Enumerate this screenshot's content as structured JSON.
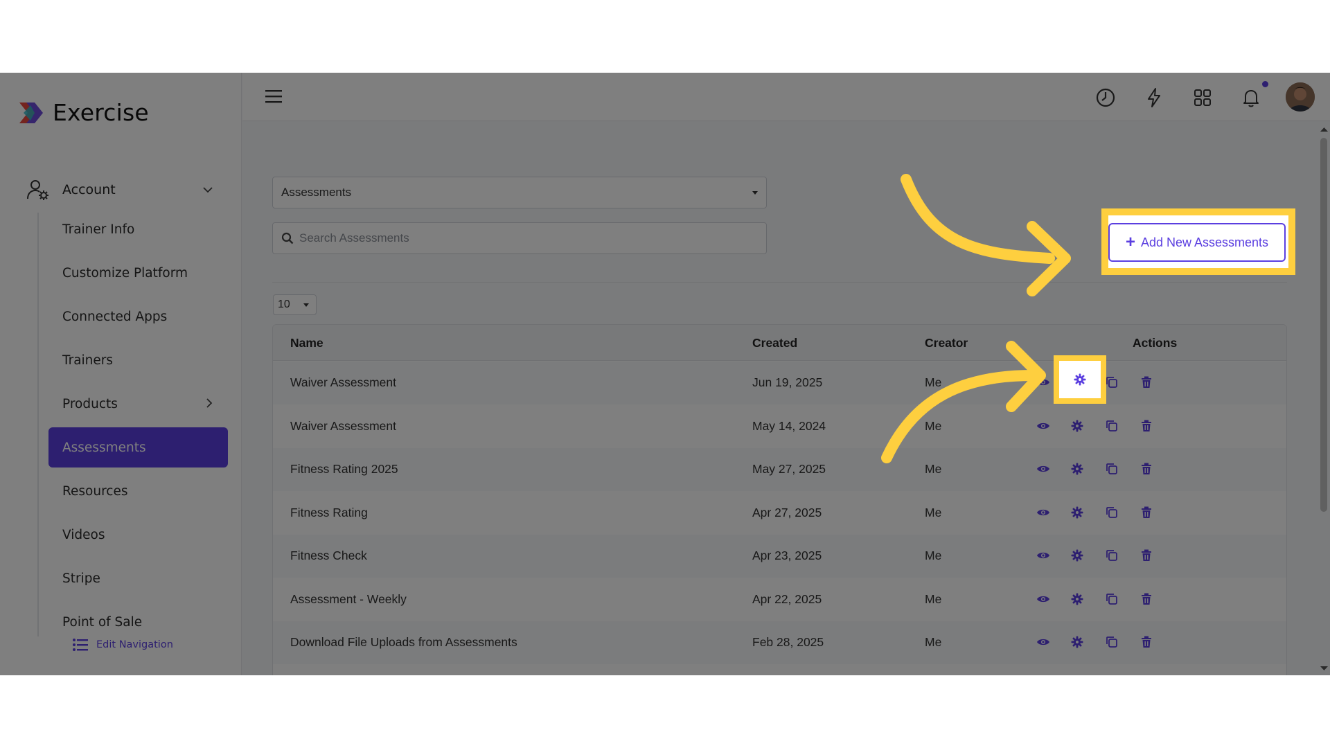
{
  "app": {
    "name": "Exercise"
  },
  "sidebar": {
    "account_label": "Account",
    "items": [
      {
        "label": "Trainer Info"
      },
      {
        "label": "Customize Platform"
      },
      {
        "label": "Connected Apps"
      },
      {
        "label": "Trainers"
      },
      {
        "label": "Products"
      },
      {
        "label": "Assessments"
      },
      {
        "label": "Resources"
      },
      {
        "label": "Videos"
      },
      {
        "label": "Stripe"
      },
      {
        "label": "Point of Sale"
      }
    ],
    "active_item": "Assessments",
    "edit_navigation": "Edit Navigation"
  },
  "header": {
    "icons": [
      "menu-icon",
      "history-icon",
      "lightning-icon",
      "apps-grid-icon",
      "bell-icon",
      "avatar"
    ],
    "notification_dot_color": "#5b3fe0"
  },
  "filters": {
    "type_select": "Assessments",
    "search_placeholder": "Search Assessments",
    "page_size": "10"
  },
  "actions": {
    "add_button": "Add New Assessments"
  },
  "table": {
    "columns": [
      "Name",
      "Created",
      "Creator",
      "Actions"
    ],
    "rows": [
      {
        "name": "Waiver Assessment",
        "created": "Jun 19, 2025",
        "creator": "Me"
      },
      {
        "name": "Waiver Assessment",
        "created": "May 14, 2024",
        "creator": "Me"
      },
      {
        "name": "Fitness Rating 2025",
        "created": "May 27, 2025",
        "creator": "Me"
      },
      {
        "name": "Fitness Rating",
        "created": "Apr 27, 2025",
        "creator": "Me"
      },
      {
        "name": "Fitness Check",
        "created": "Apr 23, 2025",
        "creator": "Me"
      },
      {
        "name": "Assessment - Weekly",
        "created": "Apr 22, 2025",
        "creator": "Me"
      },
      {
        "name": "Download File Uploads from Assessments",
        "created": "Feb 28, 2025",
        "creator": "Me"
      }
    ],
    "row_actions": [
      "eye-icon",
      "gear-icon",
      "copy-icon",
      "trash-icon"
    ]
  },
  "colors": {
    "accent": "#5b3fe0",
    "highlight": "#fecf3f",
    "overlay": "rgba(0,0,0,0.5)"
  }
}
